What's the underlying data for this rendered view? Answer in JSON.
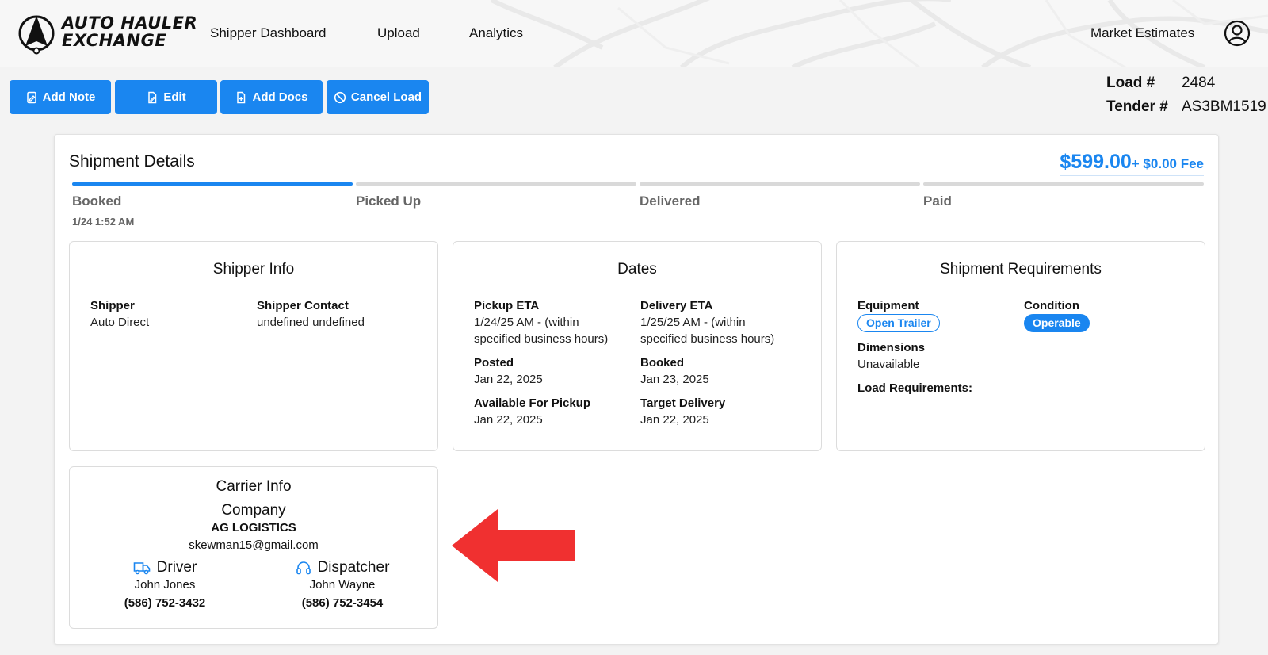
{
  "header": {
    "brand_line1": "AUTO HAULER",
    "brand_line2": "EXCHANGE",
    "nav": [
      "Shipper Dashboard",
      "Upload",
      "Analytics"
    ],
    "market_estimates": "Market Estimates",
    "account_icon": "user-circle-icon"
  },
  "toolbar": {
    "add_note": "Add Note",
    "edit": "Edit",
    "add_docs": "Add Docs",
    "cancel_load": "Cancel Load"
  },
  "load": {
    "load_label": "Load #",
    "load_value": "2484",
    "tender_label": "Tender #",
    "tender_value": "AS3BM1519"
  },
  "shipment": {
    "title": "Shipment Details",
    "price": "$599.00",
    "fee": "+ $0.00 Fee",
    "steps": [
      {
        "label": "Booked",
        "time": "1/24 1:52 AM",
        "active": true
      },
      {
        "label": "Picked Up",
        "time": "",
        "active": false
      },
      {
        "label": "Delivered",
        "time": "",
        "active": false
      },
      {
        "label": "Paid",
        "time": "",
        "active": false
      }
    ]
  },
  "shipper_info": {
    "title": "Shipper Info",
    "shipper_label": "Shipper",
    "shipper_value": "Auto Direct",
    "contact_label": "Shipper Contact",
    "contact_value": "undefined undefined"
  },
  "dates": {
    "title": "Dates",
    "pickup_eta_label": "Pickup ETA",
    "pickup_eta_value": "1/24/25 AM - (within specified business hours)",
    "delivery_eta_label": "Delivery ETA",
    "delivery_eta_value": "1/25/25 AM - (within specified business hours)",
    "posted_label": "Posted",
    "posted_value": "Jan 22, 2025",
    "booked_label": "Booked",
    "booked_value": "Jan 23, 2025",
    "available_label": "Available For Pickup",
    "available_value": "Jan 22, 2025",
    "target_label": "Target Delivery",
    "target_value": "Jan 22, 2025"
  },
  "requirements": {
    "title": "Shipment Requirements",
    "equipment_label": "Equipment",
    "equipment_value": "Open Trailer",
    "condition_label": "Condition",
    "condition_value": "Operable",
    "dimensions_label": "Dimensions",
    "dimensions_value": "Unavailable",
    "load_req_label": "Load Requirements:"
  },
  "carrier": {
    "title": "Carrier Info",
    "company_label": "Company",
    "company_name": "AG LOGISTICS",
    "email": "skewman15@gmail.com",
    "driver_label": "Driver",
    "driver_name": "John Jones",
    "driver_phone": "(586) 752-3432",
    "dispatcher_label": "Dispatcher",
    "dispatcher_name": "John Wayne",
    "dispatcher_phone": "(586) 752-3454"
  },
  "colors": {
    "accent": "#1a86f0",
    "arrow": "#f03030"
  }
}
